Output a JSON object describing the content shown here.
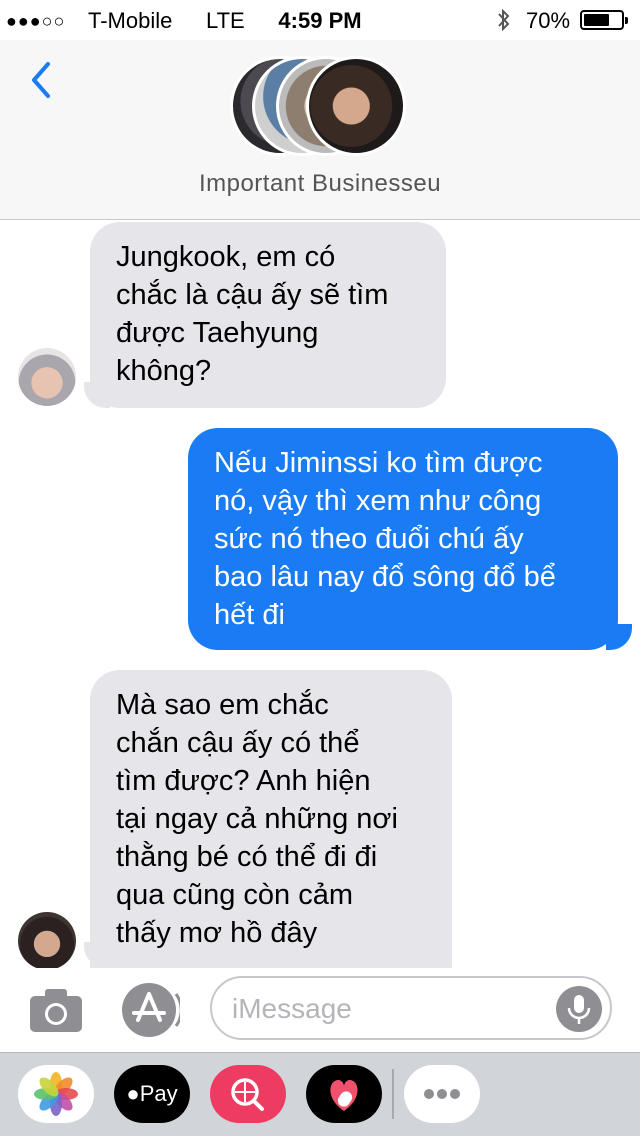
{
  "status_bar": {
    "signal": "●●●○○",
    "carrier": "T-Mobile",
    "network": "LTE",
    "time": "4:59 PM",
    "bluetooth_icon": "bluetooth-icon",
    "battery": "70%",
    "battery_level": 0.7
  },
  "header": {
    "back_icon": "chevron-left-icon",
    "group_name": "Important Businesseu"
  },
  "messages": [
    {
      "direction": "incoming",
      "lines": [
        "Jungkook, em có",
        "chắc là cậu ấy sẽ tìm",
        "được Taehyung",
        "không?"
      ]
    },
    {
      "direction": "outgoing",
      "lines": [
        "Nếu Jiminssi ko tìm được",
        "nó, vậy thì xem như công",
        "sức nó theo đuổi chú ấy",
        "bao lâu nay đổ sông đổ bể",
        "hết đi"
      ]
    },
    {
      "direction": "incoming",
      "lines": [
        "Mà sao em chắc",
        "chắn cậu ấy có thể",
        "tìm được? Anh hiện",
        "tại ngay cả những nơi",
        "thằng bé có thể đi đi",
        "qua cũng còn cảm",
        "thấy mơ hồ đây"
      ]
    }
  ],
  "input": {
    "placeholder": "iMessage",
    "camera_icon": "camera-icon",
    "appstore_icon": "app-store-icon",
    "mic_icon": "microphone-icon"
  },
  "apps": {
    "photos_icon": "photos-icon",
    "pay_label": "Pay",
    "search_icon": "image-search-icon",
    "heart_icon": "digital-touch-icon",
    "more_icon": "more-icon"
  },
  "colors": {
    "outgoing_bubble": "#1a7cf5",
    "incoming_bubble": "#e5e5ea",
    "accent": "#1a7cf5"
  }
}
